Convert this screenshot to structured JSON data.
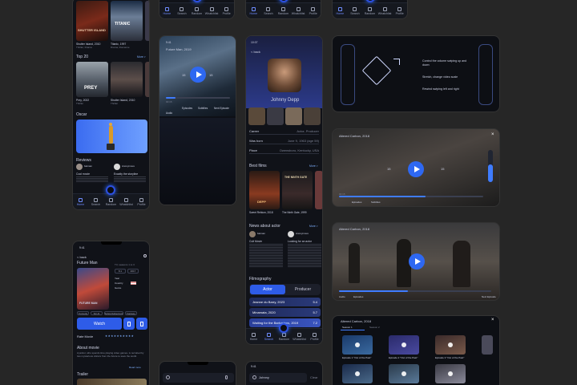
{
  "nav": {
    "home": "Home",
    "search": "Search",
    "random": "Random",
    "whatsnew": "Whatsnew",
    "whatsnew_short": "Whatchlist",
    "profile": "Profile"
  },
  "home": {
    "poster1_caption": "Shutter Island, 2010",
    "poster1_sub": "Thriller, Drama",
    "poster2_caption": "Titanic, 1997",
    "poster2_sub": "Drama, Romance",
    "poster1_title": "SHUTTER ISLAND",
    "poster2_title": "TITANIC",
    "top20": "Top 20",
    "more": "More >",
    "top1_caption": "Prey, 2022",
    "top1_sub": "Thriller",
    "top2_caption": "Shutter Island, 2010",
    "top2_sub": "Thriller",
    "top1_title": "PREY",
    "oscar": "Oscar",
    "reviews": "Reviews",
    "review1_user": "batman",
    "review2_user": "Anonymous",
    "review1_title": "Cool movie",
    "review2_title": "Exactly the storyline"
  },
  "player_portrait": {
    "time": "9:41",
    "title": "Future Man, 2019",
    "rewind": "15",
    "forward": "15",
    "elapsed": "00:15",
    "episodes": "Episodes",
    "subtitles": "Subtitles",
    "next": "Next Episode",
    "audio": "Audio"
  },
  "actor": {
    "time": "10:07",
    "back": "< back",
    "name": "Johnny Depp",
    "career_label": "Career",
    "career_value": "Actor, Producer",
    "born_label": "Was born",
    "born_value": "June 9, 1963 (age 59)",
    "place_label": "Place",
    "place_value": "Owensboro, Kentucky, USA",
    "best_films": "Best films",
    "more": "More >",
    "film1": "Sweet Rebium, 2018",
    "film2": "The Ninth Gate, 1999",
    "film1_title": "DEPP",
    "film2_title": "THE NINTH GATE",
    "news": "News about actor",
    "news1_title": "Cult Movie",
    "news1_user": "batman",
    "news2_user": "Anonymous",
    "news2_title": "Looking for an actor",
    "filmography": "Filmography",
    "tab_actor": "Actor",
    "tab_producer": "Producer",
    "film_list": [
      {
        "title": "Jeanne du Barry, 2023",
        "rating": "5.4"
      },
      {
        "title": "Minamata, 2020",
        "rating": "5.7"
      },
      {
        "title": "Waiting for the Barbarians, 2019",
        "rating": "7.2"
      }
    ]
  },
  "gestures": {
    "g1": "Control the volume swiping up and down",
    "g2": "Stretch, change video scale",
    "g3": "Rewind swiping left and right"
  },
  "landscape1": {
    "title": "Altered Carbon, 2018",
    "rewind": "15",
    "forward": "15",
    "elapsed": "00:15",
    "episodes": "Episodes",
    "subtitles": "Subtitles"
  },
  "landscape2": {
    "title": "Altered Carbon, 2018",
    "episodes": "Episodes",
    "audio": "Audio",
    "next": "Next Episode"
  },
  "season_list": {
    "title": "Altered Carbon, 2018",
    "season1": "Season 1",
    "season2": "Season 2",
    "ep1": "Episode 1 \"Out of the Past\"",
    "ep2": "Episode 2 \"Out of the Past\"",
    "ep3": "Episode 3 \"Out of the Past\""
  },
  "movie": {
    "time": "9:41",
    "back": "< back",
    "title": "Future Man",
    "duration": "TV, seasons 1 to 3",
    "rating_label": "8.1",
    "year_label": "Year",
    "year": "2017",
    "country_label": "Country",
    "genre_label": "Genre",
    "tags": [
      "Comedy",
      "Sci-Fi",
      "Action/Adventure",
      "Fantasy"
    ],
    "watch": "Watch",
    "rate": "Rate Movie",
    "stars": "★★★★★★★★★★",
    "about": "About movie",
    "about_text": "A janitor, who spends time playing video games, is recruited by two mysterious visitors from the future to save the world.",
    "more": "Read more",
    "trailer": "Trailer",
    "poster_title": "FUTURE MAN"
  },
  "search": {
    "time": "9:41",
    "placeholder": "Johnny",
    "clear": "Clear"
  },
  "colors": {
    "accent": "#2e68f2",
    "background": "#262626",
    "panel": "#101218"
  }
}
